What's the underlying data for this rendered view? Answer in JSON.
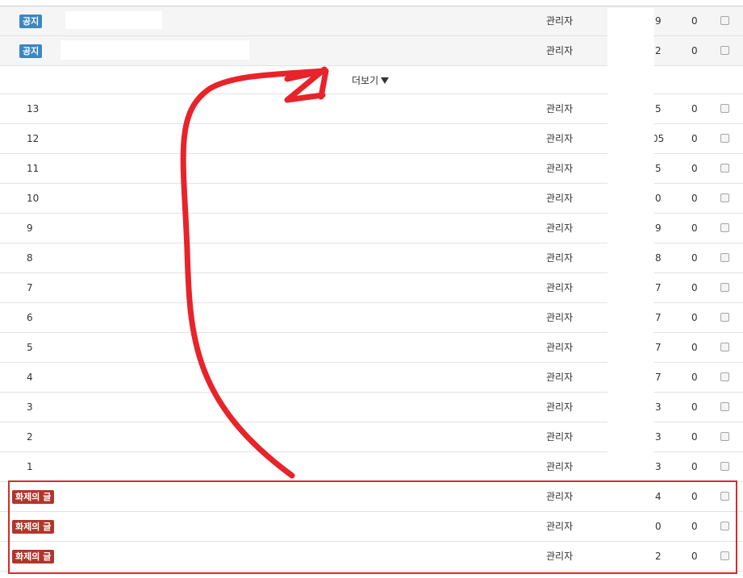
{
  "notices": [
    {
      "badge": "공지",
      "author": "관리자",
      "views": "9",
      "likes": "0"
    },
    {
      "badge": "공지",
      "author": "관리자",
      "views": "2",
      "likes": "0"
    }
  ],
  "more": {
    "label": "더보기"
  },
  "posts": [
    {
      "num": "13",
      "author": "관리자",
      "views": "5",
      "likes": "0"
    },
    {
      "num": "12",
      "author": "관리자",
      "views": "05",
      "likes": "0"
    },
    {
      "num": "11",
      "author": "관리자",
      "views": "5",
      "likes": "0"
    },
    {
      "num": "10",
      "author": "관리자",
      "views": "0",
      "likes": "0"
    },
    {
      "num": "9",
      "author": "관리자",
      "views": "9",
      "likes": "0"
    },
    {
      "num": "8",
      "author": "관리자",
      "views": "8",
      "likes": "0"
    },
    {
      "num": "7",
      "author": "관리자",
      "views": "7",
      "likes": "0"
    },
    {
      "num": "6",
      "author": "관리자",
      "views": "7",
      "likes": "0"
    },
    {
      "num": "5",
      "author": "관리자",
      "views": "7",
      "likes": "0"
    },
    {
      "num": "4",
      "author": "관리자",
      "views": "7",
      "likes": "0"
    },
    {
      "num": "3",
      "author": "관리자",
      "views": "3",
      "likes": "0"
    },
    {
      "num": "2",
      "author": "관리자",
      "views": "3",
      "likes": "0"
    },
    {
      "num": "1",
      "author": "관리자",
      "views": "3",
      "likes": "0"
    }
  ],
  "hot": [
    {
      "badge": "화제의 글",
      "author": "관리자",
      "views": "4",
      "likes": "0"
    },
    {
      "badge": "화제의 글",
      "author": "관리자",
      "views": "0",
      "likes": "0"
    },
    {
      "badge": "화제의 글",
      "author": "관리자",
      "views": "2",
      "likes": "0"
    }
  ],
  "colors": {
    "notice_badge": "#3a87c4",
    "hot_badge": "#b0362b",
    "annotation": "#d82a2a"
  },
  "icons": {
    "more": "caret-down-icon",
    "row_select": "checkbox"
  }
}
